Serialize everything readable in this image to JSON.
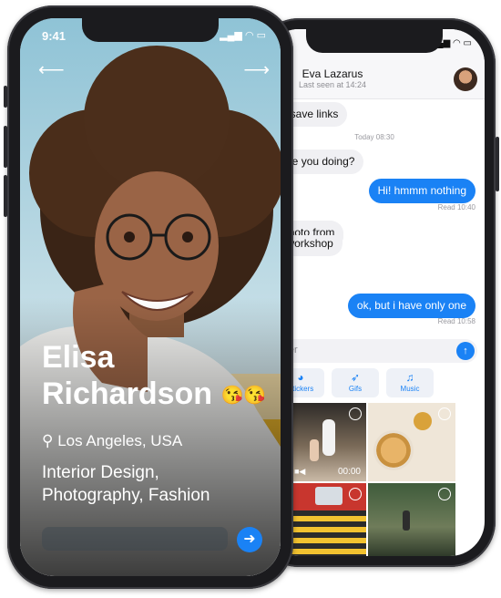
{
  "profile": {
    "status_time": "9:41",
    "name_line1": "Elisa",
    "name_line2": "Richardson",
    "emoji": "😘😘",
    "location": "Los Angeles, USA",
    "interests_line1": "Interior Design,",
    "interests_line2": "Photography, Fashion",
    "back_icon": "arrow-left-icon",
    "forward_icon": "arrow-right-icon"
  },
  "chat": {
    "contact_name": "Eva Lazarus",
    "last_seen": "Last seen at 14:24",
    "messages": [
      {
        "dir": "in",
        "text": "ently save links"
      },
      {
        "dir": "day",
        "text": "Today 08:30"
      },
      {
        "dir": "in",
        "text": "hat are you doing?"
      },
      {
        "dir": "out",
        "text": "Hi! hmmm nothing",
        "meta": "Read 10:40"
      },
      {
        "dir": "in",
        "text": "e a photo from"
      },
      {
        "dir": "in",
        "text": "ay’s workshop"
      },
      {
        "dir": "in",
        "text": "😆"
      },
      {
        "dir": "out",
        "text": "ok, but i have only one",
        "meta": "Read 10:58"
      }
    ],
    "input_placeholder": "eholder",
    "tabs": [
      {
        "label": "Stickers",
        "icon": "sticker-icon"
      },
      {
        "label": "Gifs",
        "icon": "rocket-icon"
      },
      {
        "label": "Music",
        "icon": "music-note-icon"
      }
    ],
    "video_duration": "00:00"
  },
  "colors": {
    "accent": "#1a82f5",
    "bubble_in": "#f0f0f3",
    "phone_body": "#1b1b1e"
  }
}
